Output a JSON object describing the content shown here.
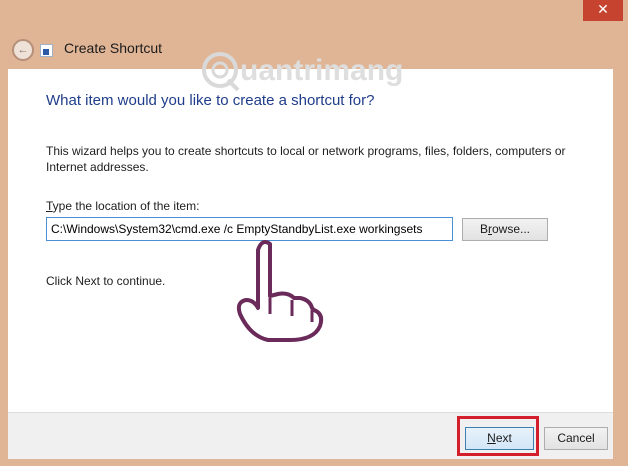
{
  "window": {
    "title": "Create Shortcut",
    "close_glyph": "✕"
  },
  "watermark": {
    "text": "uantrimang"
  },
  "wizard": {
    "heading": "What item would you like to create a shortcut for?",
    "description": "This wizard helps you to create shortcuts to local or network programs, files, folders, computers or Internet addresses.",
    "location_label_accel": "T",
    "location_label_rest": "ype the location of the item:",
    "location_value": "C:\\Windows\\System32\\cmd.exe /c EmptyStandbyList.exe workingsets",
    "browse_accel": "r",
    "browse_before": "B",
    "browse_after": "owse...",
    "continue_text": "Click Next to continue."
  },
  "footer": {
    "next_accel": "N",
    "next_rest": "ext",
    "cancel_label": "Cancel"
  },
  "icons": {
    "back": "back-arrow-icon",
    "app": "shortcut-icon",
    "hand": "pointing-hand-icon"
  }
}
